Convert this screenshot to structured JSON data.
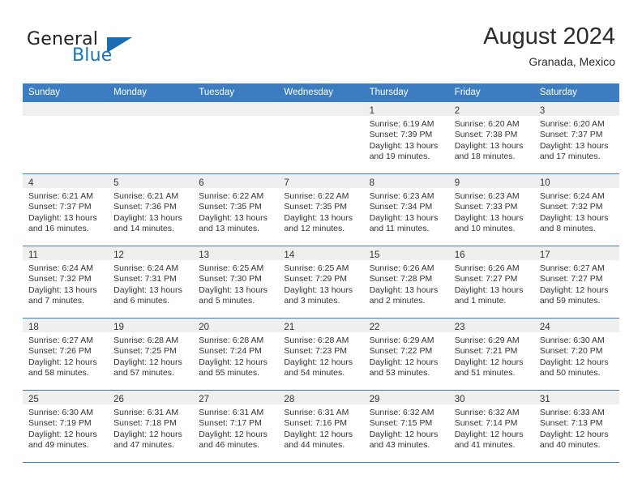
{
  "brand": {
    "name_part1": "General",
    "name_part2": "Blue",
    "logo_icon": "triangle-logo-icon"
  },
  "header": {
    "title": "August 2024",
    "subtitle": "Granada, Mexico"
  },
  "colors": {
    "header_blue": "#3b7dc0",
    "row_divider_blue": "#3b7dc0",
    "daynum_band": "#efefef",
    "empty_cell": "#f0f0f0",
    "brand_blue": "#1b75bb",
    "text": "#333333"
  },
  "calendar": {
    "weekday_headers": [
      "Sunday",
      "Monday",
      "Tuesday",
      "Wednesday",
      "Thursday",
      "Friday",
      "Saturday"
    ],
    "weeks": [
      [
        {
          "day": "",
          "lines": []
        },
        {
          "day": "",
          "lines": []
        },
        {
          "day": "",
          "lines": []
        },
        {
          "day": "",
          "lines": []
        },
        {
          "day": "1",
          "lines": [
            "Sunrise: 6:19 AM",
            "Sunset: 7:39 PM",
            "Daylight: 13 hours",
            "and 19 minutes."
          ]
        },
        {
          "day": "2",
          "lines": [
            "Sunrise: 6:20 AM",
            "Sunset: 7:38 PM",
            "Daylight: 13 hours",
            "and 18 minutes."
          ]
        },
        {
          "day": "3",
          "lines": [
            "Sunrise: 6:20 AM",
            "Sunset: 7:37 PM",
            "Daylight: 13 hours",
            "and 17 minutes."
          ]
        }
      ],
      [
        {
          "day": "4",
          "lines": [
            "Sunrise: 6:21 AM",
            "Sunset: 7:37 PM",
            "Daylight: 13 hours",
            "and 16 minutes."
          ]
        },
        {
          "day": "5",
          "lines": [
            "Sunrise: 6:21 AM",
            "Sunset: 7:36 PM",
            "Daylight: 13 hours",
            "and 14 minutes."
          ]
        },
        {
          "day": "6",
          "lines": [
            "Sunrise: 6:22 AM",
            "Sunset: 7:35 PM",
            "Daylight: 13 hours",
            "and 13 minutes."
          ]
        },
        {
          "day": "7",
          "lines": [
            "Sunrise: 6:22 AM",
            "Sunset: 7:35 PM",
            "Daylight: 13 hours",
            "and 12 minutes."
          ]
        },
        {
          "day": "8",
          "lines": [
            "Sunrise: 6:23 AM",
            "Sunset: 7:34 PM",
            "Daylight: 13 hours",
            "and 11 minutes."
          ]
        },
        {
          "day": "9",
          "lines": [
            "Sunrise: 6:23 AM",
            "Sunset: 7:33 PM",
            "Daylight: 13 hours",
            "and 10 minutes."
          ]
        },
        {
          "day": "10",
          "lines": [
            "Sunrise: 6:24 AM",
            "Sunset: 7:32 PM",
            "Daylight: 13 hours",
            "and 8 minutes."
          ]
        }
      ],
      [
        {
          "day": "11",
          "lines": [
            "Sunrise: 6:24 AM",
            "Sunset: 7:32 PM",
            "Daylight: 13 hours",
            "and 7 minutes."
          ]
        },
        {
          "day": "12",
          "lines": [
            "Sunrise: 6:24 AM",
            "Sunset: 7:31 PM",
            "Daylight: 13 hours",
            "and 6 minutes."
          ]
        },
        {
          "day": "13",
          "lines": [
            "Sunrise: 6:25 AM",
            "Sunset: 7:30 PM",
            "Daylight: 13 hours",
            "and 5 minutes."
          ]
        },
        {
          "day": "14",
          "lines": [
            "Sunrise: 6:25 AM",
            "Sunset: 7:29 PM",
            "Daylight: 13 hours",
            "and 3 minutes."
          ]
        },
        {
          "day": "15",
          "lines": [
            "Sunrise: 6:26 AM",
            "Sunset: 7:28 PM",
            "Daylight: 13 hours",
            "and 2 minutes."
          ]
        },
        {
          "day": "16",
          "lines": [
            "Sunrise: 6:26 AM",
            "Sunset: 7:27 PM",
            "Daylight: 13 hours",
            "and 1 minute."
          ]
        },
        {
          "day": "17",
          "lines": [
            "Sunrise: 6:27 AM",
            "Sunset: 7:27 PM",
            "Daylight: 12 hours",
            "and 59 minutes."
          ]
        }
      ],
      [
        {
          "day": "18",
          "lines": [
            "Sunrise: 6:27 AM",
            "Sunset: 7:26 PM",
            "Daylight: 12 hours",
            "and 58 minutes."
          ]
        },
        {
          "day": "19",
          "lines": [
            "Sunrise: 6:28 AM",
            "Sunset: 7:25 PM",
            "Daylight: 12 hours",
            "and 57 minutes."
          ]
        },
        {
          "day": "20",
          "lines": [
            "Sunrise: 6:28 AM",
            "Sunset: 7:24 PM",
            "Daylight: 12 hours",
            "and 55 minutes."
          ]
        },
        {
          "day": "21",
          "lines": [
            "Sunrise: 6:28 AM",
            "Sunset: 7:23 PM",
            "Daylight: 12 hours",
            "and 54 minutes."
          ]
        },
        {
          "day": "22",
          "lines": [
            "Sunrise: 6:29 AM",
            "Sunset: 7:22 PM",
            "Daylight: 12 hours",
            "and 53 minutes."
          ]
        },
        {
          "day": "23",
          "lines": [
            "Sunrise: 6:29 AM",
            "Sunset: 7:21 PM",
            "Daylight: 12 hours",
            "and 51 minutes."
          ]
        },
        {
          "day": "24",
          "lines": [
            "Sunrise: 6:30 AM",
            "Sunset: 7:20 PM",
            "Daylight: 12 hours",
            "and 50 minutes."
          ]
        }
      ],
      [
        {
          "day": "25",
          "lines": [
            "Sunrise: 6:30 AM",
            "Sunset: 7:19 PM",
            "Daylight: 12 hours",
            "and 49 minutes."
          ]
        },
        {
          "day": "26",
          "lines": [
            "Sunrise: 6:31 AM",
            "Sunset: 7:18 PM",
            "Daylight: 12 hours",
            "and 47 minutes."
          ]
        },
        {
          "day": "27",
          "lines": [
            "Sunrise: 6:31 AM",
            "Sunset: 7:17 PM",
            "Daylight: 12 hours",
            "and 46 minutes."
          ]
        },
        {
          "day": "28",
          "lines": [
            "Sunrise: 6:31 AM",
            "Sunset: 7:16 PM",
            "Daylight: 12 hours",
            "and 44 minutes."
          ]
        },
        {
          "day": "29",
          "lines": [
            "Sunrise: 6:32 AM",
            "Sunset: 7:15 PM",
            "Daylight: 12 hours",
            "and 43 minutes."
          ]
        },
        {
          "day": "30",
          "lines": [
            "Sunrise: 6:32 AM",
            "Sunset: 7:14 PM",
            "Daylight: 12 hours",
            "and 41 minutes."
          ]
        },
        {
          "day": "31",
          "lines": [
            "Sunrise: 6:33 AM",
            "Sunset: 7:13 PM",
            "Daylight: 12 hours",
            "and 40 minutes."
          ]
        }
      ]
    ]
  }
}
